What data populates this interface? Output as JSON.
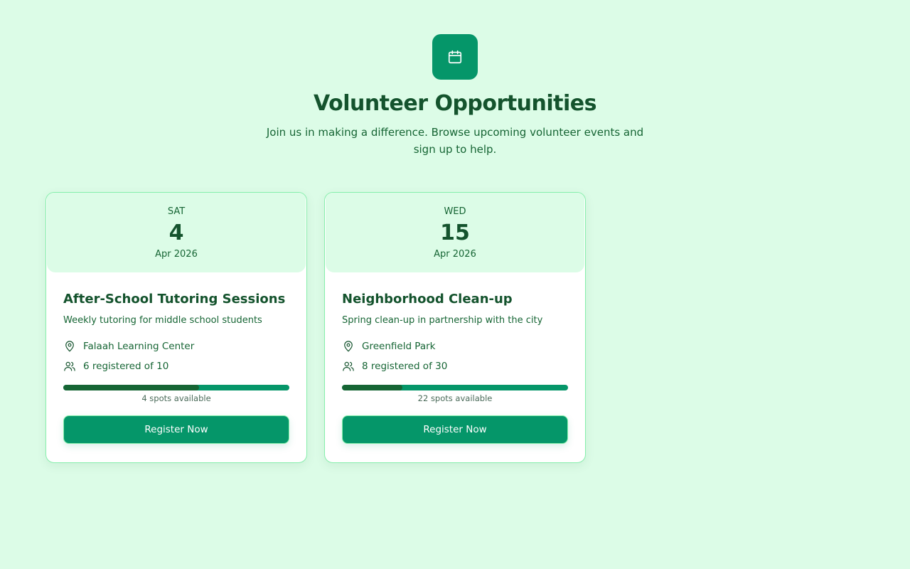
{
  "header": {
    "icon": "calendar-icon",
    "title": "Volunteer Opportunities",
    "subtitle": "Join us in making a difference. Browse upcoming volunteer events and sign up to help."
  },
  "colors": {
    "background": "#dcfce7",
    "accent": "#059669",
    "text_dark": "#14532d",
    "progress_fill": "#166534"
  },
  "events": [
    {
      "weekday": "SAT",
      "day": "4",
      "month_year": "Apr 2026",
      "title": "After-School Tutoring Sessions",
      "description": "Weekly tutoring for middle school students",
      "location": "Falaah Learning Center",
      "registered_text": "6 registered of 10",
      "registered": 6,
      "capacity": 10,
      "spots_text": "4 spots available",
      "button_label": "Register Now"
    },
    {
      "weekday": "WED",
      "day": "15",
      "month_year": "Apr 2026",
      "title": "Neighborhood Clean-up",
      "description": "Spring clean-up in partnership with the city",
      "location": "Greenfield Park",
      "registered_text": "8 registered of 30",
      "registered": 8,
      "capacity": 30,
      "spots_text": "22 spots available",
      "button_label": "Register Now"
    }
  ]
}
